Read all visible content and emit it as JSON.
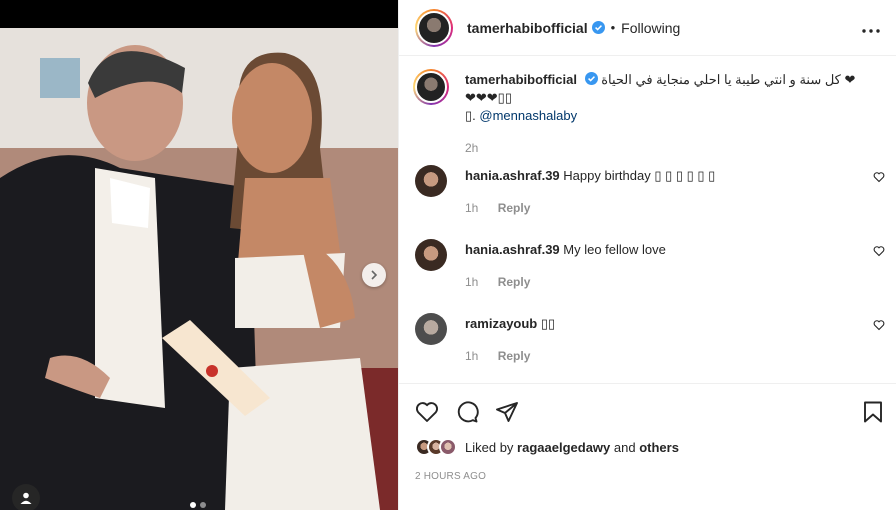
{
  "post": {
    "username": "tamerhabibofficial",
    "follow_status": "Following",
    "more_icon": "more-dots-icon"
  },
  "caption": {
    "username": "tamerhabibofficial",
    "text": "كل سنة و انتي طيبة يا احلي منجاية في الحياة ❤❤❤❤▯▯",
    "mention_prefix": "▯.",
    "mention": "@mennashalaby",
    "time": "2h"
  },
  "comments": [
    {
      "username": "hania.ashraf.39",
      "text": "Happy birthday ▯ ▯ ▯ ▯ ▯ ▯",
      "time": "1h",
      "reply": "Reply"
    },
    {
      "username": "hania.ashraf.39",
      "text": "My leo fellow love",
      "time": "1h",
      "reply": "Reply"
    },
    {
      "username": "ramizayoub",
      "text": "▯▯",
      "time": "1h",
      "reply": "Reply"
    }
  ],
  "actions": {
    "like_icon": "heart-icon",
    "comment_icon": "comment-icon",
    "share_icon": "share-icon",
    "save_icon": "bookmark-icon"
  },
  "likes": {
    "prefix": "Liked by",
    "user": "ragaaelgedawy",
    "and": "and",
    "others": "others"
  },
  "timestamp": "2 HOURS AGO",
  "colors": {
    "verified": "#3897f0",
    "mention": "#00376b",
    "secondary": "#8e8e8e"
  }
}
